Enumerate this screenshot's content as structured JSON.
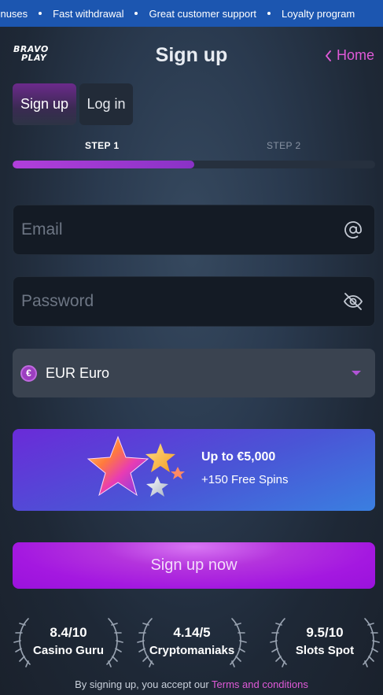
{
  "ticker": {
    "items": [
      "bonuses",
      "Fast withdrawal",
      "Great customer support",
      "Loyalty program"
    ]
  },
  "header": {
    "logo": {
      "line1": "BRAVO",
      "line2": "PLAY"
    },
    "title": "Sign up",
    "home_label": "Home"
  },
  "tabs": [
    {
      "label": "Sign up",
      "active": true
    },
    {
      "label": "Log in",
      "active": false
    }
  ],
  "steps": {
    "step1": "STEP 1",
    "step2": "STEP 2",
    "progress_percent": 50
  },
  "form": {
    "email": {
      "placeholder": "Email",
      "value": "",
      "icon": "at-icon"
    },
    "password": {
      "placeholder": "Password",
      "value": "",
      "icon": "eye-off-icon"
    },
    "currency": {
      "symbol": "€",
      "value": "EUR Euro"
    }
  },
  "promo": {
    "title": "Up to €5,000",
    "subtitle": "+150 Free Spins"
  },
  "cta": {
    "label": "Sign up now"
  },
  "ratings": [
    {
      "score": "8.4/10",
      "site": "Casino Guru"
    },
    {
      "score": "4.14/5",
      "site": "Cryptomaniaks"
    },
    {
      "score": "9.5/10",
      "site": "Slots Spot"
    }
  ],
  "terms": {
    "prefix": "By signing up, you accept our ",
    "link": "Terms and conditions"
  },
  "colors": {
    "accent": "#a418e0",
    "link": "#e05ad8",
    "ticker_bg": "#1c56b0"
  }
}
